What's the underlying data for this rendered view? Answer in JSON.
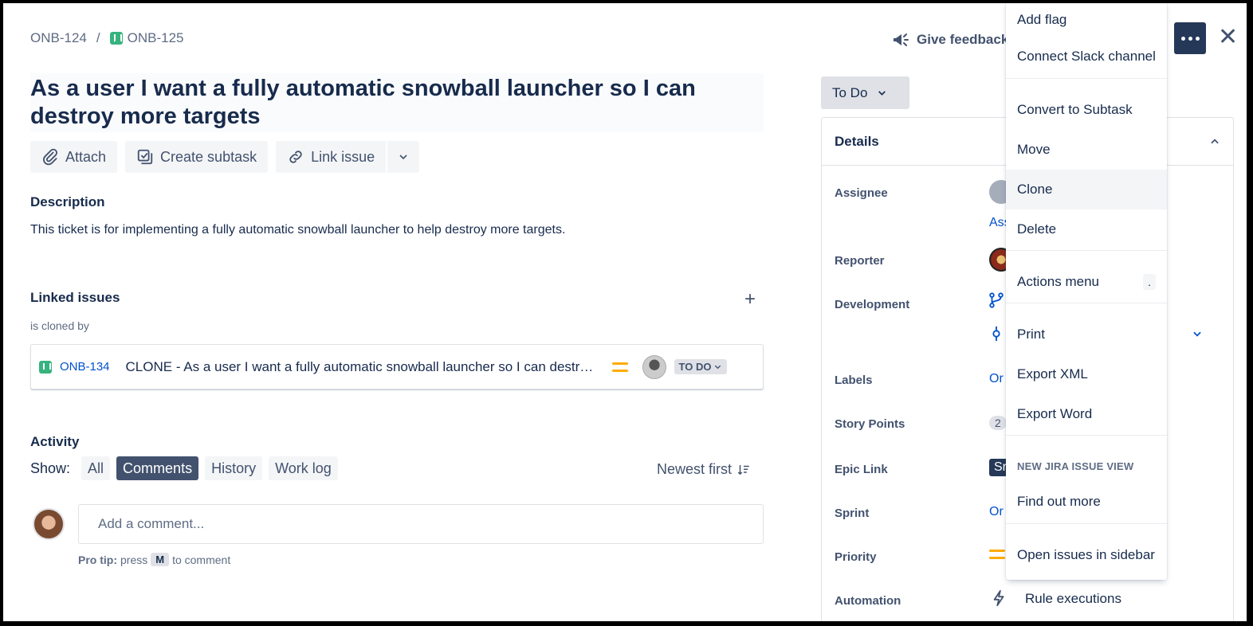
{
  "breadcrumb": {
    "parent": "ONB-124",
    "separator": "/",
    "issue": "ONB-125"
  },
  "issue": {
    "title": "As a user I want a fully automatic snowball launcher so I can destroy more targets"
  },
  "actions": {
    "attach": "Attach",
    "create_subtask": "Create subtask",
    "link_issue": "Link issue"
  },
  "description": {
    "heading": "Description",
    "text": "This ticket is for implementing a fully automatic snowball launcher to help destroy more targets."
  },
  "linked_issues": {
    "heading": "Linked issues",
    "add": "+",
    "relation": "is cloned by",
    "items": [
      {
        "key": "ONB-134",
        "summary": "CLONE - As a user I want a fully automatic snowball launcher so I can destroy more targets",
        "status": "TO DO"
      }
    ]
  },
  "activity": {
    "heading": "Activity",
    "show_label": "Show:",
    "filters": [
      "All",
      "Comments",
      "History",
      "Work log"
    ],
    "active_filter": "Comments",
    "sort": "Newest first",
    "comment_placeholder": "Add a comment...",
    "pro_tip_label": "Pro tip:",
    "pro_tip_pre": "press",
    "pro_tip_key": "M",
    "pro_tip_post": "to comment"
  },
  "header": {
    "give_feedback": "Give feedback",
    "close": "✕"
  },
  "status": {
    "label": "To Do"
  },
  "details": {
    "heading": "Details",
    "fields": {
      "assignee": "Assignee",
      "assignee_link": "Ass",
      "reporter": "Reporter",
      "development": "Development",
      "labels": "Labels",
      "labels_val": "Or",
      "story_points": "Story Points",
      "story_points_val": "2",
      "epic_link": "Epic Link",
      "epic_val": "Sr",
      "sprint": "Sprint",
      "sprint_val": "Or",
      "priority": "Priority",
      "automation": "Automation",
      "rule_executions": "Rule executions"
    }
  },
  "menu": {
    "add_flag": "Add flag",
    "connect_slack": "Connect Slack channel",
    "convert": "Convert to Subtask",
    "move": "Move",
    "clone": "Clone",
    "delete": "Delete",
    "actions_menu": "Actions menu",
    "actions_shortcut": ".",
    "print": "Print",
    "export_xml": "Export XML",
    "export_word": "Export Word",
    "group_label": "NEW JIRA ISSUE VIEW",
    "find_out_more": "Find out more",
    "open_sidebar": "Open issues in sidebar"
  },
  "colors": {
    "primary_dark": "#253858",
    "link": "#0052cc",
    "story_green": "#36b37e",
    "priority_medium": "#ffab00"
  }
}
